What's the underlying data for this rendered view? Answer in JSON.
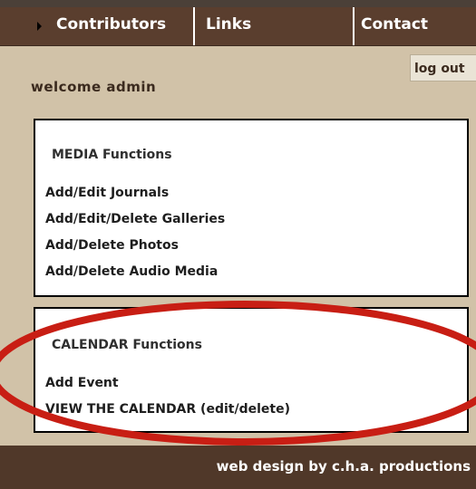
{
  "nav": {
    "items": [
      {
        "label": "Contributors"
      },
      {
        "label": "Links"
      },
      {
        "label": "Contact"
      }
    ]
  },
  "header": {
    "welcome": "welcome admin",
    "logout": "log out"
  },
  "media": {
    "title": "MEDIA Functions",
    "links": [
      "Add/Edit Journals",
      "Add/Edit/Delete Galleries",
      "Add/Delete Photos",
      "Add/Delete Audio Media"
    ]
  },
  "calendar": {
    "title": "CALENDAR Functions",
    "links": [
      "Add Event",
      "VIEW THE CALENDAR (edit/delete)"
    ]
  },
  "footer": {
    "credit": "web design by c.h.a. productions"
  },
  "colors": {
    "nav_background": "#5a3e2e",
    "page_background": "#d1c2a8",
    "footer_background": "#503829",
    "highlight_ellipse": "#c81e14"
  }
}
